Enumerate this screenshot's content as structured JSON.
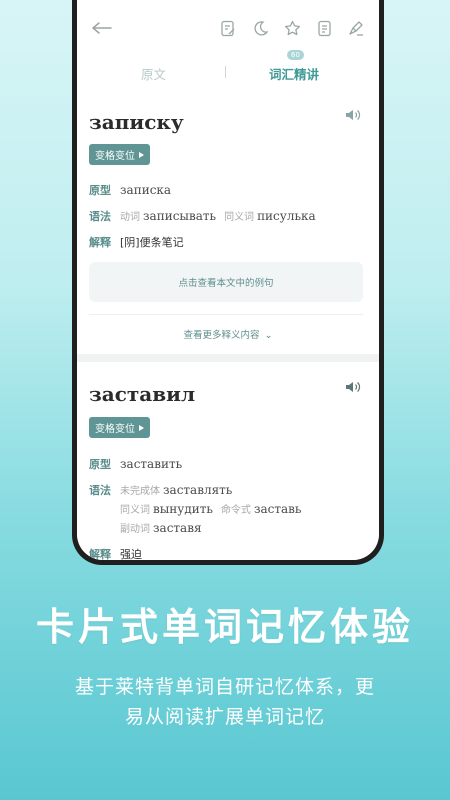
{
  "toolbar": {
    "icons": [
      "back-arrow-icon",
      "edit-note-icon",
      "night-mode-icon",
      "star-icon",
      "document-icon",
      "clean-icon"
    ]
  },
  "tabs": {
    "original": "原文",
    "vocab": "词汇精讲",
    "vocab_badge": "60"
  },
  "card1": {
    "word": "записку",
    "decl_button": "变格变位",
    "original_label": "原型",
    "original_value": "записка",
    "grammar_label": "语法",
    "grammar_items": [
      {
        "tag": "动词",
        "value": "записывать"
      },
      {
        "tag": "同义词",
        "value": "писулька"
      }
    ],
    "meaning_label": "解释",
    "meaning_value": "[阴]便条笔记",
    "examples_button": "点击查看本文中的例句",
    "more_button": "查看更多释义内容"
  },
  "card2": {
    "word": "заставил",
    "decl_button": "变格变位",
    "original_label": "原型",
    "original_value": "заставить",
    "grammar_label": "语法",
    "grammar_lines": [
      [
        {
          "tag": "未完成体",
          "value": "заставлять"
        }
      ],
      [
        {
          "tag": "同义词",
          "value": "вынудить"
        },
        {
          "tag": "命令式",
          "value": "заставь"
        }
      ],
      [
        {
          "tag": "副动词",
          "value": "заставя"
        }
      ]
    ],
    "meaning_label": "解释",
    "meaning_value": "强迫"
  },
  "promo": {
    "headline": "卡片式单词记忆体验",
    "sub_line1": "基于莱特背单词自研记忆体系，更",
    "sub_line2": "易从阅读扩展单词记忆"
  },
  "colors": {
    "accent": "#5f9695",
    "label": "#5b8e8d",
    "background_top": "#d8f5f6",
    "background_bottom": "#59c7d1"
  }
}
